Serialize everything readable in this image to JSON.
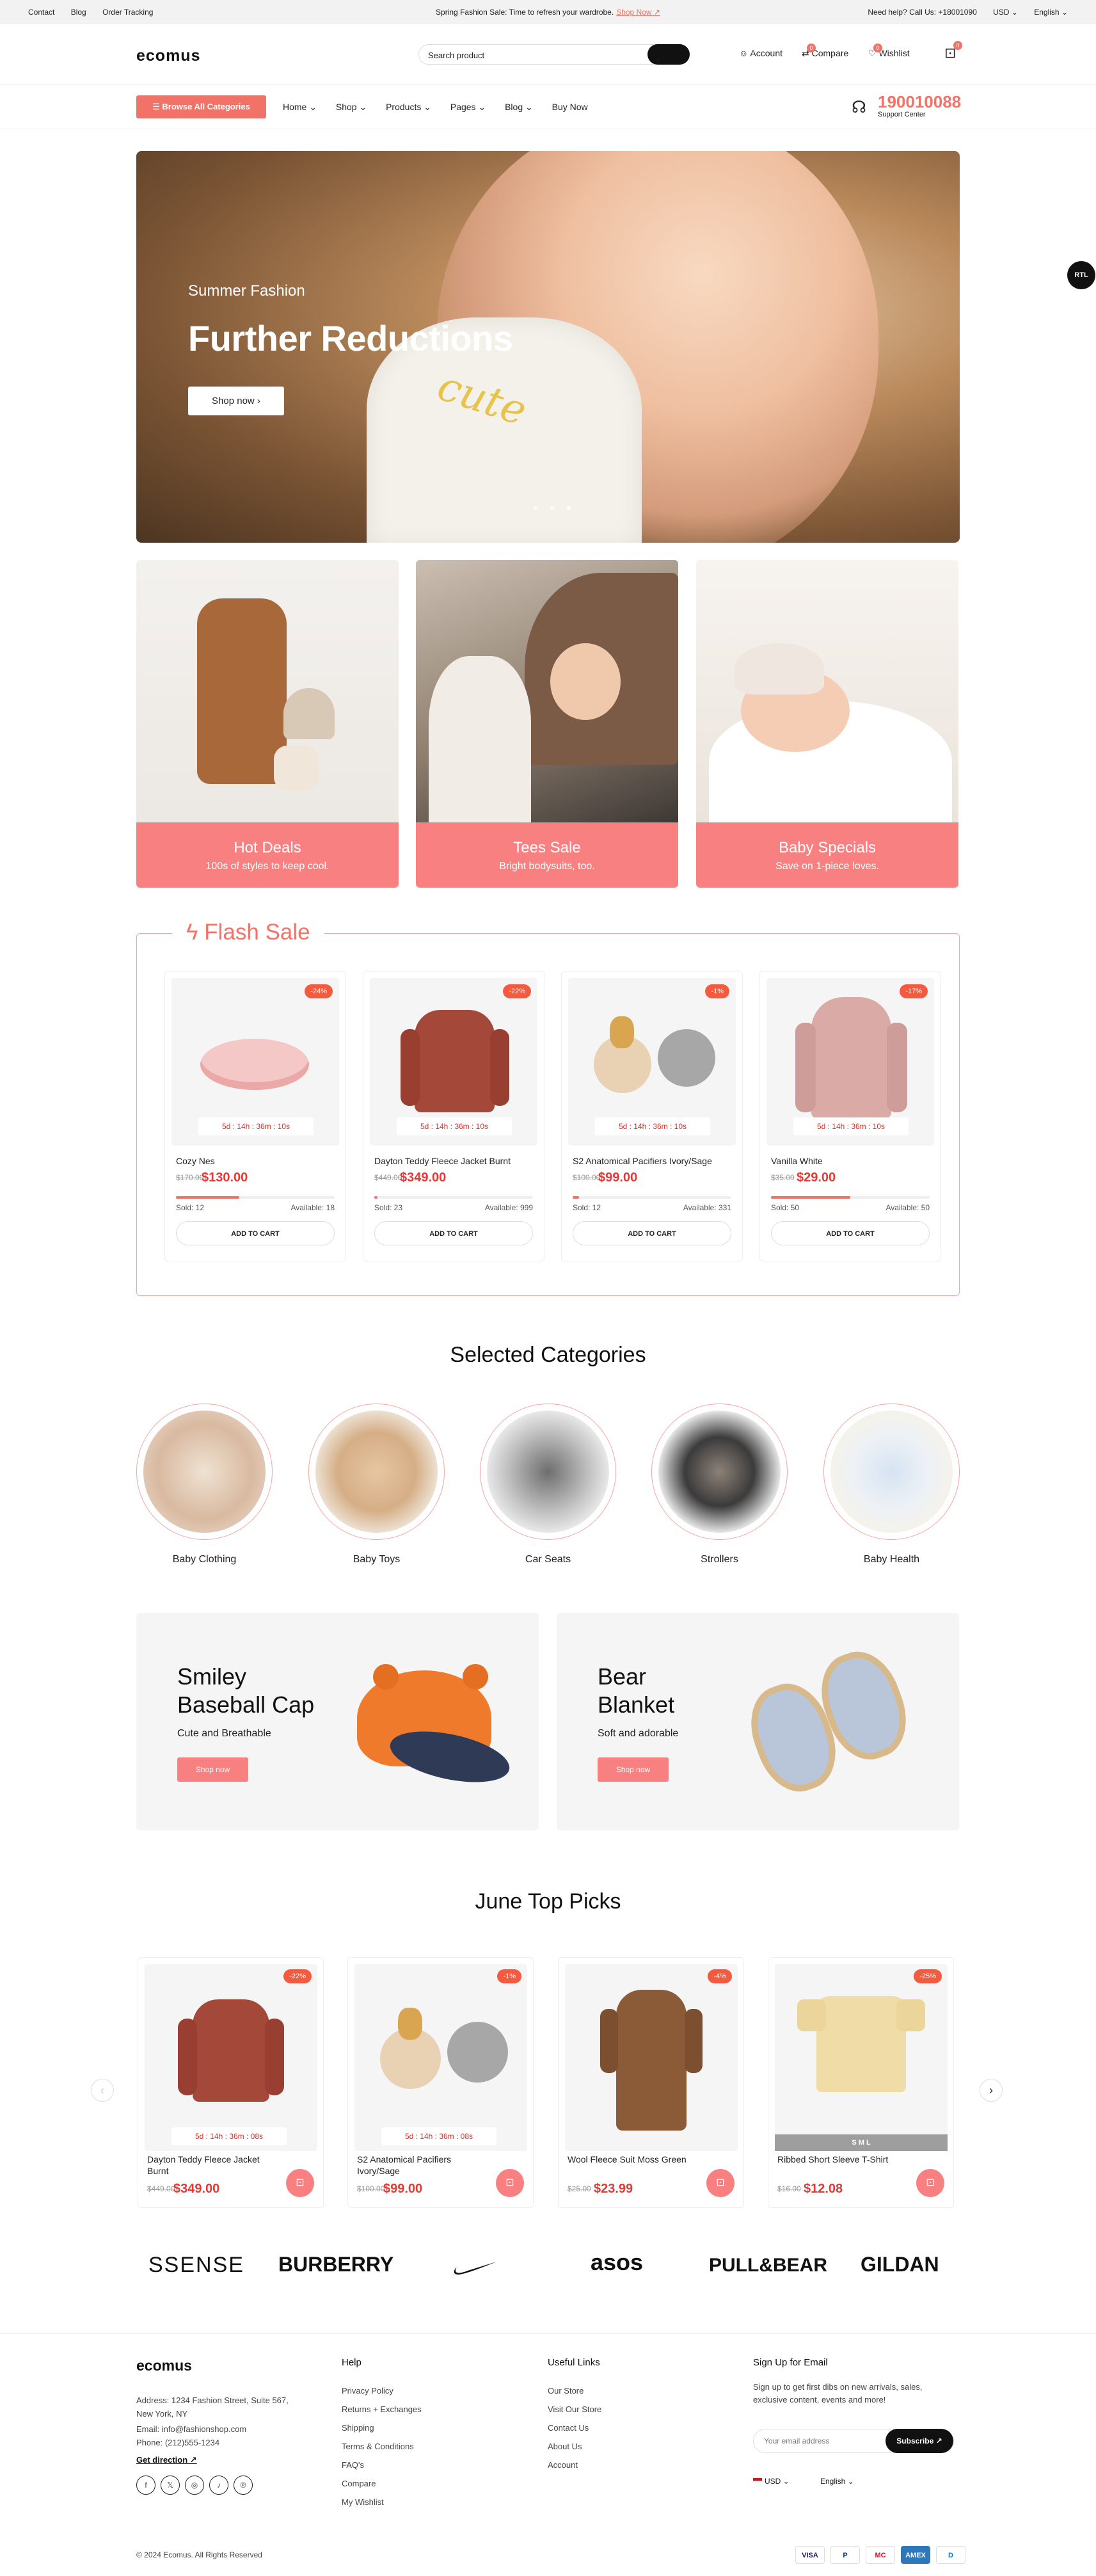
{
  "topbar": {
    "links": [
      "Contact",
      "Blog",
      "Order Tracking"
    ],
    "promo_text": "Spring Fashion Sale: Time to refresh your wardrobe.",
    "promo_link": "Shop Now ↗",
    "help": "Need help? Call Us: +18001090",
    "currency": "USD",
    "language": "English"
  },
  "header": {
    "logo": "ecomus",
    "search_placeholder": "Search product",
    "account": "Account",
    "compare": "Compare",
    "compare_count": "0",
    "wishlist": "Wishlist",
    "wishlist_count": "0",
    "cart_count": "0"
  },
  "nav": {
    "browse": "Browse All Categories",
    "items": [
      "Home",
      "Shop",
      "Products",
      "Pages",
      "Blog",
      "Buy Now"
    ],
    "phone": "190010088",
    "support": "Support Center"
  },
  "hero": {
    "subtitle": "Summer Fashion",
    "title": "Further Reductions",
    "button": "Shop now",
    "shirt_text": "cute"
  },
  "rtl": "RTL",
  "categories": [
    {
      "title": "Hot Deals",
      "sub": "100s of styles to keep cool."
    },
    {
      "title": "Tees Sale",
      "sub": "Bright bodysuits, too."
    },
    {
      "title": "Baby Specials",
      "sub": "Save on 1-piece loves."
    }
  ],
  "flash": {
    "title": "Flash Sale",
    "products": [
      {
        "name": "Cozy Nes",
        "old": "$170.00",
        "price": "$130.00",
        "disc": "-24%",
        "cd": "5d : 14h : 36m : 10s",
        "sold": "Sold: 12",
        "avail": "Available: 18",
        "progress": 0.4,
        "add": "ADD TO CART"
      },
      {
        "name": "Dayton Teddy Fleece Jacket Burnt",
        "old": "$449.00",
        "price": "$349.00",
        "disc": "-22%",
        "cd": "5d : 14h : 36m : 10s",
        "sold": "Sold: 23",
        "avail": "Available: 999",
        "progress": 0.02,
        "add": "ADD TO CART"
      },
      {
        "name": "S2 Anatomical Pacifiers Ivory/Sage",
        "old": "$100.00",
        "price": "$99.00",
        "disc": "-1%",
        "cd": "5d : 14h : 36m : 10s",
        "sold": "Sold: 12",
        "avail": "Available: 331",
        "progress": 0.04,
        "add": "ADD TO CART"
      },
      {
        "name": "Vanilla White",
        "old": "$35.00",
        "price": "$29.00",
        "disc": "-17%",
        "cd": "5d : 14h : 36m : 10s",
        "sold": "Sold: 50",
        "avail": "Available: 50",
        "progress": 0.5,
        "add": "ADD TO CART"
      }
    ]
  },
  "selected": {
    "title": "Selected Categories",
    "items": [
      "Baby Clothing",
      "Baby Toys",
      "Car Seats",
      "Strollers",
      "Baby Health"
    ]
  },
  "promos": [
    {
      "title": "Smiley Baseball Cap",
      "sub": "Cute and Breathable",
      "btn": "Shop now"
    },
    {
      "title": "Bear Blanket",
      "sub": "Soft and adorable",
      "btn": "Shop now"
    }
  ],
  "toppicks": {
    "title": "June Top Picks",
    "products": [
      {
        "name": "Dayton Teddy Fleece Jacket Burnt",
        "old": "$449.00",
        "price": "$349.00",
        "disc": "-22%",
        "cd": "5d : 14h : 36m : 08s"
      },
      {
        "name": "S2 Anatomical Pacifiers Ivory/Sage",
        "old": "$100.00",
        "price": "$99.00",
        "disc": "-1%",
        "cd": "5d : 14h : 36m : 08s"
      },
      {
        "name": "Wool Fleece Suit Moss Green",
        "old": "$25.00",
        "price": "$23.99",
        "disc": "-4%",
        "cd": ""
      },
      {
        "name": "Ribbed Short Sleeve T-Shirt",
        "old": "$16.00",
        "price": "$12.08",
        "disc": "-25%",
        "cd": "",
        "sizes": "S   M   L"
      }
    ]
  },
  "brands": [
    "SSENSE",
    "BURBERRY",
    "Nike",
    "asos",
    "PULL&BEAR",
    "GILDAN"
  ],
  "footer": {
    "logo": "ecomus",
    "address": "Address: 1234 Fashion Street, Suite 567, New York, NY",
    "email": "Email: info@fashionshop.com",
    "phone": "Phone: (212)555-1234",
    "direction": "Get direction ↗",
    "help_title": "Help",
    "help": [
      "Privacy Policy",
      "Returns + Exchanges",
      "Shipping",
      "Terms & Conditions",
      "FAQ's",
      "Compare",
      "My Wishlist"
    ],
    "links_title": "Useful Links",
    "links": [
      "Our Store",
      "Visit Our Store",
      "Contact Us",
      "About Us",
      "Account"
    ],
    "signup_title": "Sign Up for Email",
    "signup_text": "Sign up to get first dibs on new arrivals, sales, exclusive content, events and more!",
    "email_placeholder": "Your email address",
    "subscribe": "Subscribe ↗",
    "currency": "USD",
    "language": "English",
    "copyright": "© 2024 Ecomus. All Rights Reserved",
    "payments": [
      "VISA",
      "P",
      "MC",
      "AMEX",
      "D"
    ]
  }
}
